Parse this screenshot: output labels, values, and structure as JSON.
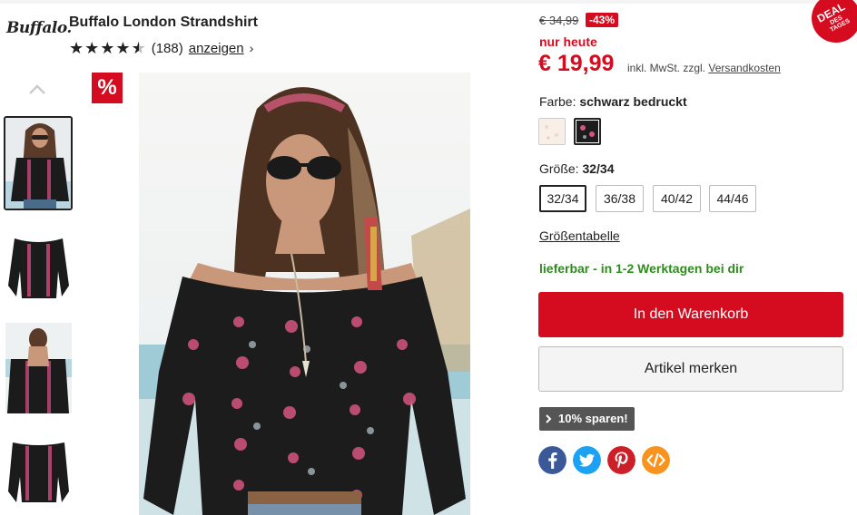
{
  "brand": {
    "logo_text": "Buffalo",
    "logo_mark": "."
  },
  "product": {
    "title": "Buffalo London Strandshirt",
    "rating_count": "(188)",
    "rating_link": "anzeigen",
    "rating_stars": 4.5
  },
  "gallery": {
    "sale_badge": "%",
    "thumbnails": [
      "thumb-1",
      "thumb-2",
      "thumb-3",
      "thumb-4"
    ]
  },
  "pricing": {
    "old_price": "€ 34,99",
    "discount": "-43%",
    "only_today": "nur heute",
    "price": "€ 19,99",
    "tax_text": "inkl. MwSt. zzgl.",
    "shipping_link": "Versandkosten"
  },
  "deal_badge": {
    "line1": "DEAL",
    "line2": "DES",
    "line3": "TAGES"
  },
  "color": {
    "label": "Farbe:",
    "selected": "schwarz bedruckt"
  },
  "size": {
    "label": "Größe:",
    "selected": "32/34",
    "options": [
      "32/34",
      "36/38",
      "40/42",
      "44/46"
    ]
  },
  "size_chart_link": "Größentabelle",
  "availability": "lieferbar - in 1-2 Werktagen bei dir",
  "cart_button": "In den Warenkorb",
  "wishlist_button": "Artikel merken",
  "save_badge": "10% sparen!",
  "share_icons": [
    "facebook-icon",
    "twitter-icon",
    "pinterest-icon",
    "embed-icon"
  ],
  "colors": {
    "accent_red": "#d50b1f",
    "available_green": "#2e8b1e",
    "facebook": "#3b5998",
    "twitter": "#1da1f2",
    "pinterest": "#cb2027",
    "embed": "#f7931e"
  }
}
